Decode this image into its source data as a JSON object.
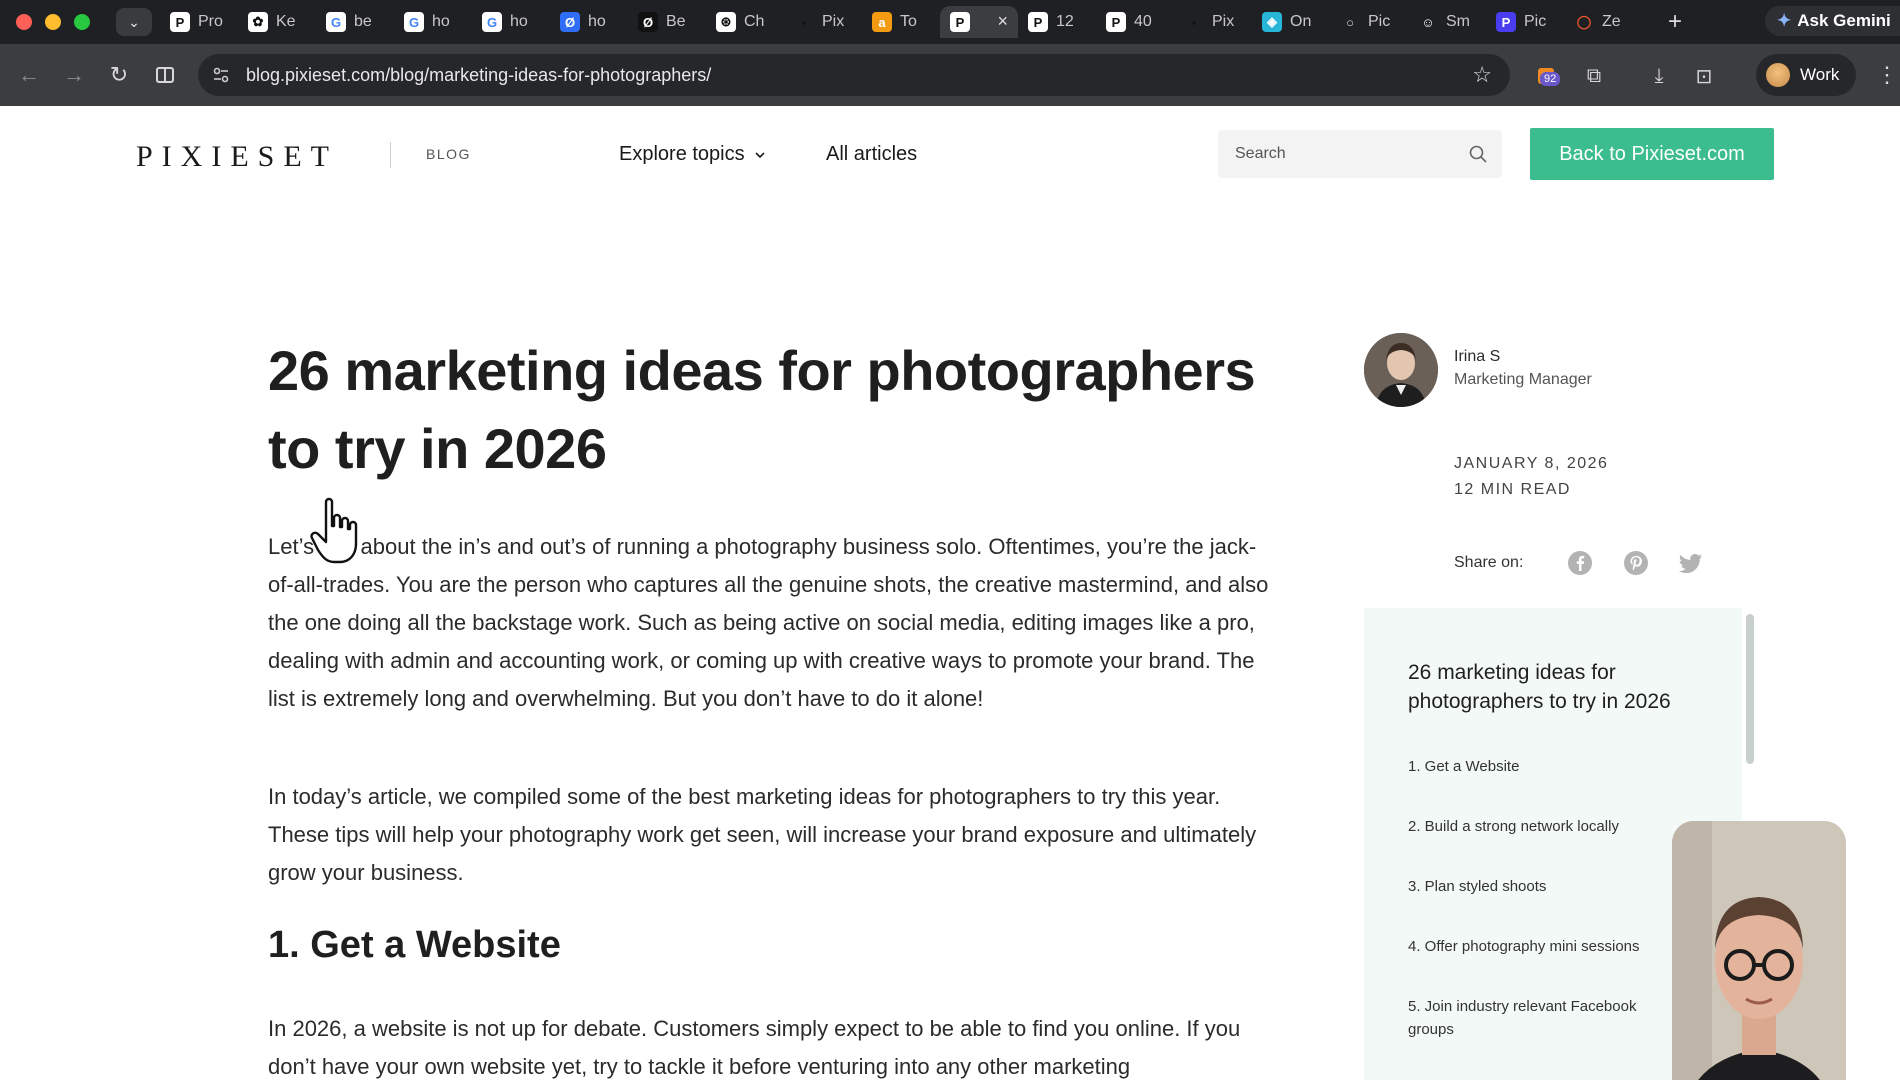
{
  "browser": {
    "tabs": [
      {
        "label": "Pro",
        "fav_char": "P",
        "fav_bg": "#ffffff",
        "fav_fg": "#111111"
      },
      {
        "label": "Ke",
        "fav_char": "✿",
        "fav_bg": "#ffffff",
        "fav_fg": "#111111"
      },
      {
        "label": "be",
        "fav_char": "G",
        "fav_bg": "#ffffff",
        "fav_fg": "#4285f4"
      },
      {
        "label": "ho",
        "fav_char": "G",
        "fav_bg": "#ffffff",
        "fav_fg": "#4285f4"
      },
      {
        "label": "ho",
        "fav_char": "G",
        "fav_bg": "#ffffff",
        "fav_fg": "#4285f4"
      },
      {
        "label": "ho",
        "fav_char": "Ø",
        "fav_bg": "#2f6df6",
        "fav_fg": "#ffffff"
      },
      {
        "label": "Be",
        "fav_char": "Ø",
        "fav_bg": "#111111",
        "fav_fg": "#ffffff"
      },
      {
        "label": "Ch",
        "fav_char": "⊛",
        "fav_bg": "#ffffff",
        "fav_fg": "#111111"
      },
      {
        "label": "Pix",
        "fav_char": "▪",
        "fav_bg": "#1f2023",
        "fav_fg": "#111111"
      },
      {
        "label": "To",
        "fav_char": "a",
        "fav_bg": "#f39c12",
        "fav_fg": "#ffffff"
      },
      {
        "label": "",
        "fav_char": "P",
        "fav_bg": "#ffffff",
        "fav_fg": "#111111",
        "active": true
      },
      {
        "label": "12",
        "fav_char": "P",
        "fav_bg": "#ffffff",
        "fav_fg": "#111111"
      },
      {
        "label": "40",
        "fav_char": "P",
        "fav_bg": "#ffffff",
        "fav_fg": "#111111"
      },
      {
        "label": "Pix",
        "fav_char": "▪",
        "fav_bg": "#1f2023",
        "fav_fg": "#111111"
      },
      {
        "label": "On",
        "fav_char": "◈",
        "fav_bg": "#27b5d8",
        "fav_fg": "#ffffff"
      },
      {
        "label": "Pic",
        "fav_char": "○",
        "fav_bg": "#1f2023",
        "fav_fg": "#dddddd"
      },
      {
        "label": "Sm",
        "fav_char": "☺",
        "fav_bg": "#1f2023",
        "fav_fg": "#ffffff"
      },
      {
        "label": "Pic",
        "fav_char": "P",
        "fav_bg": "#4a3df0",
        "fav_fg": "#ffffff"
      },
      {
        "label": "Ze",
        "fav_char": "◯",
        "fav_bg": "#1f2023",
        "fav_fg": "#e8522d"
      }
    ],
    "active_tab_close": "×",
    "new_tab": "+",
    "ask_gemini": "Ask Gemini",
    "url": "blog.pixieset.com/blog/marketing-ideas-for-photographers/",
    "extension_badge": "92",
    "profile_label": "Work"
  },
  "site": {
    "logo": "PIXIESET",
    "blog_label": "BLOG",
    "nav_explore": "Explore topics",
    "nav_all": "All articles",
    "search_placeholder": "Search",
    "back_button": "Back to Pixieset.com",
    "accent_color": "#3cbd8e"
  },
  "article": {
    "title": "26 marketing ideas for photographers to try in 2026",
    "paragraph_1": "Let’s talk about the in’s and out’s of running a photography business solo. Oftentimes, you’re the jack-of-all-trades. You are the person who captures all the genuine shots, the creative mastermind, and also the one doing all the backstage work. Such as being active on social media, editing images like a pro, dealing with admin and accounting work, or coming up with creative ways to promote your brand. The list is extremely long and overwhelming. But you don’t have to do it alone!",
    "paragraph_2": "In today’s article, we compiled some of the best marketing ideas for photographers to try this year. These tips will help your photography work get seen, will increase your brand exposure and ultimately grow your business.",
    "heading_1": "1. Get a Website",
    "paragraph_3": "In 2026, a website is not up for debate. Customers simply expect to be able to find you online. If you don’t have your own website yet, try to tackle it before venturing into any other marketing"
  },
  "sidebar": {
    "author_name": "Irina S",
    "author_role": "Marketing Manager",
    "date": "JANUARY 8, 2026",
    "read_time": "12 MIN READ",
    "share_label": "Share on:",
    "toc_title": "26 marketing ideas for photographers to try in 2026",
    "toc_items": [
      "1. Get a Website",
      "2. Build a strong network locally",
      "3. Plan styled shoots",
      "4. Offer photography mini sessions",
      "5. Join industry relevant Facebook groups"
    ]
  }
}
